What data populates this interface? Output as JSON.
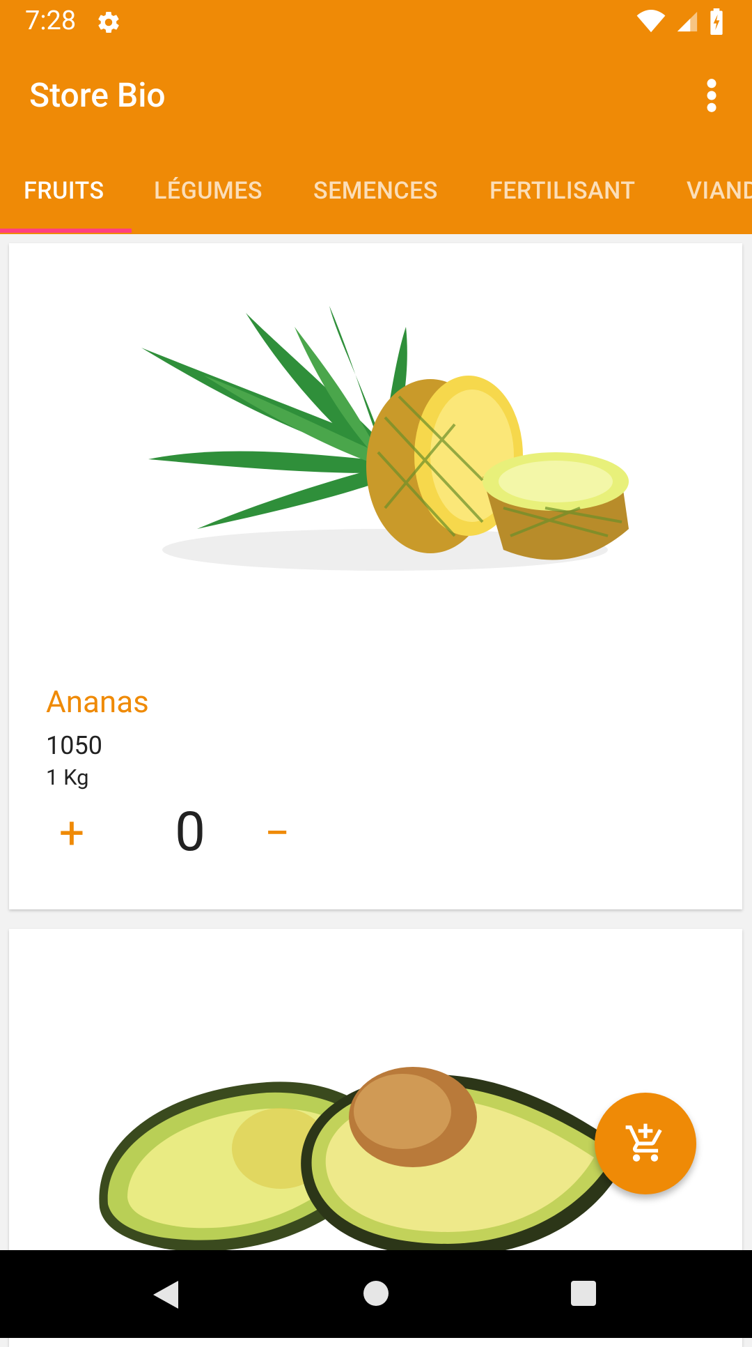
{
  "status_bar": {
    "time": "7:28"
  },
  "app_bar": {
    "title": "Store Bio"
  },
  "tabs": [
    {
      "label": "FRUITS",
      "active": true
    },
    {
      "label": "LÉGUMES",
      "active": false
    },
    {
      "label": "SEMENCES",
      "active": false
    },
    {
      "label": "FERTILISANT",
      "active": false
    },
    {
      "label": "VIAND",
      "active": false
    }
  ],
  "products": [
    {
      "name": "Ananas",
      "price": "1050",
      "unit": "1 Kg",
      "quantity": "0",
      "plus_label": "+",
      "minus_label": "−",
      "image": "pineapple-image"
    },
    {
      "image": "avocado-image"
    }
  ],
  "colors": {
    "primary": "#ef8a06",
    "accent": "#ff4081"
  },
  "icons": [
    "gear-icon",
    "wifi-icon",
    "signal-icon",
    "battery-icon",
    "more-vert-icon",
    "add-shopping-cart-icon",
    "back-icon",
    "home-icon",
    "recents-icon"
  ]
}
